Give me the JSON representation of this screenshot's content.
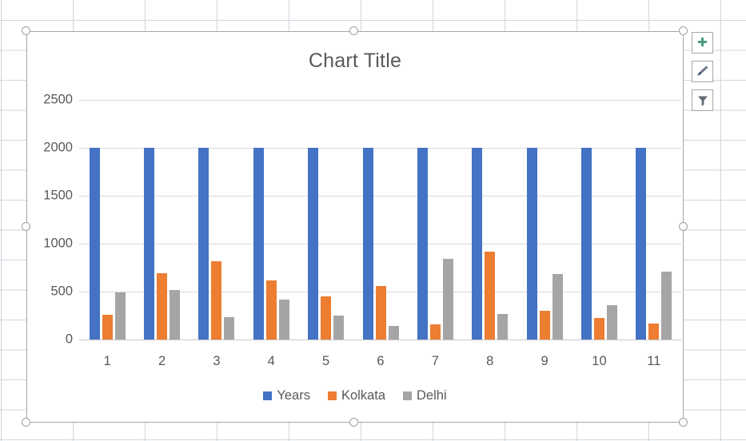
{
  "chart_data": {
    "type": "bar",
    "title": "Chart Title",
    "xlabel": "",
    "ylabel": "",
    "categories": [
      "1",
      "2",
      "3",
      "4",
      "5",
      "6",
      "7",
      "8",
      "9",
      "10",
      "11"
    ],
    "series": [
      {
        "name": "Years",
        "color": "#4472C4",
        "values": [
          2000,
          2000,
          2000,
          2000,
          2000,
          2000,
          2000,
          2000,
          2000,
          2000,
          2000
        ]
      },
      {
        "name": "Kolkata",
        "color": "#ED7D31",
        "values": [
          255,
          690,
          815,
          620,
          450,
          555,
          160,
          915,
          300,
          225,
          165
        ]
      },
      {
        "name": "Delhi",
        "color": "#A5A5A5",
        "values": [
          490,
          520,
          230,
          420,
          250,
          140,
          845,
          265,
          680,
          360,
          705
        ]
      }
    ],
    "ylim": [
      0,
      2500
    ],
    "yticks": [
      0,
      500,
      1000,
      1500,
      2000,
      2500
    ],
    "ytick_labels": [
      "0",
      "500",
      "1000",
      "1500",
      "2000",
      "2500"
    ],
    "grid": true,
    "legend_position": "bottom"
  },
  "chart_buttons": [
    {
      "name": "chart-elements",
      "icon": "plus-icon",
      "color": "#4E9A83"
    },
    {
      "name": "chart-styles",
      "icon": "paintbrush-icon",
      "color": "#5A5A5A"
    },
    {
      "name": "chart-filters",
      "icon": "funnel-icon",
      "color": "#5A5A5A"
    }
  ],
  "selection": {
    "handles": [
      "top-left",
      "top-center",
      "top-right",
      "middle-left",
      "middle-right",
      "bottom-left",
      "bottom-center",
      "bottom-right"
    ]
  }
}
